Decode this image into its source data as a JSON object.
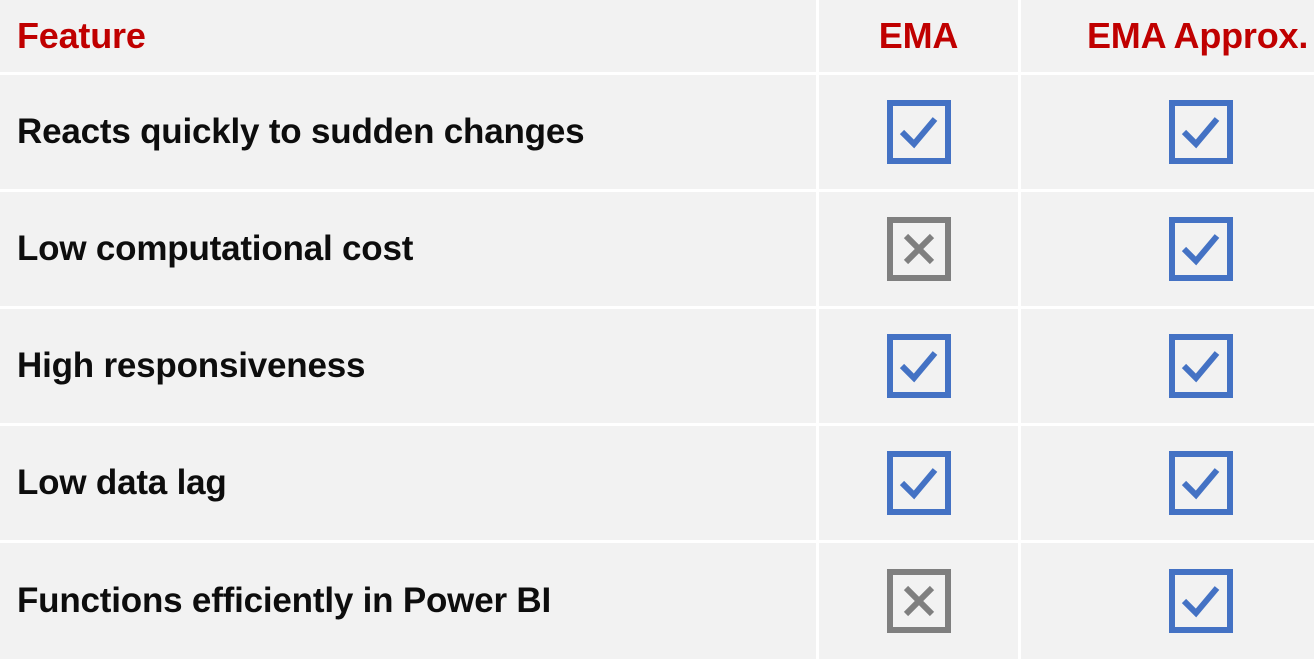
{
  "colors": {
    "header_text": "#c00000",
    "cell_bg": "#f2f2f2",
    "check": "#4472c4",
    "cross": "#7f7f7f"
  },
  "header": {
    "feature": "Feature",
    "ema": "EMA",
    "ema_approx": "EMA Approx."
  },
  "rows": [
    {
      "feature": "Reacts quickly to sudden changes",
      "ema": "check",
      "ema_approx": "check"
    },
    {
      "feature": "Low computational cost",
      "ema": "cross",
      "ema_approx": "check"
    },
    {
      "feature": "High responsiveness",
      "ema": "check",
      "ema_approx": "check"
    },
    {
      "feature": "Low data lag",
      "ema": "check",
      "ema_approx": "check"
    },
    {
      "feature": "Functions efficiently in Power BI",
      "ema": "cross",
      "ema_approx": "check"
    }
  ]
}
